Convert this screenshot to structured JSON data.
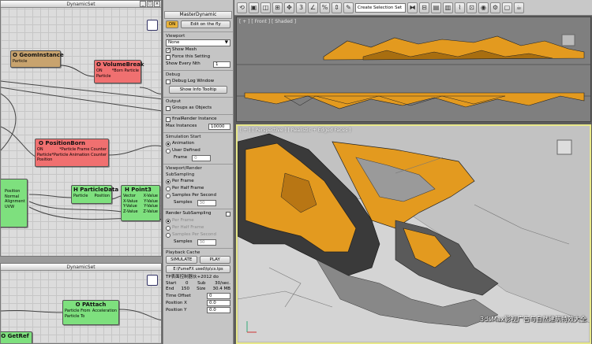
{
  "graph": {
    "title": "DynamicSet",
    "nodes": {
      "geom": {
        "title": "O GeomInstance",
        "left": "Particle"
      },
      "volume": {
        "title": "O VolumeBreak",
        "in1": "ON",
        "out1": "*Born Particle",
        "in2": "Particle"
      },
      "born": {
        "title": "O PositionBorn",
        "in1": "ON",
        "out1": "*Particle Frame Counter",
        "in2": "Particle",
        "out2": "*Particle Animation Counter",
        "in3": "Position"
      },
      "partial": {
        "lines": [
          "Position",
          "Normal",
          "Alignment",
          "UVW"
        ]
      },
      "pdata": {
        "title": "H ParticleData",
        "p1": "Particle",
        "p2": "Position"
      },
      "point3": {
        "title": "H Point3",
        "rows": [
          [
            "Vector",
            "X-Value"
          ],
          [
            "X-Value",
            "Y-Value"
          ],
          [
            "Y-Value",
            "Y-Value"
          ],
          [
            "Z-Value",
            "Z-Value"
          ]
        ]
      }
    }
  },
  "graph2": {
    "title": "DynamicSet",
    "nodes": {
      "attach": {
        "title": "O PAttach",
        "r1a": "Particle From",
        "r1b": "Acceleration",
        "r2": "Particle To"
      },
      "getref": {
        "title": "O GetRef"
      }
    }
  },
  "panel": {
    "title": "MasterDynamic",
    "on_label": "ON",
    "edit_label": "Edit on the fly",
    "viewport": {
      "header": "Viewport",
      "select": "None",
      "show_mesh": "Show Mesh",
      "force": "Force this Setting",
      "show_every": "Show Every Nth",
      "show_every_val": "1"
    },
    "debug": {
      "header": "Debug",
      "log": "Debug Log Window",
      "tooltip": "Show Info Tooltip"
    },
    "output": {
      "header": "Output",
      "groups": "Groups as Objects"
    },
    "render": {
      "final": "finalRender Instance",
      "max_label": "Max Instances",
      "max_val": "10000"
    },
    "sim": {
      "header": "Simulation Start",
      "animation": "Animation",
      "user": "User Defined",
      "frame": "Frame",
      "frame_val": "0"
    },
    "vrs": {
      "header": "Viewport/Render SubSampling",
      "per_frame": "Per Frame",
      "per_half": "Per Half Frame",
      "per_second": "Samples Per Second",
      "samples": "Samples",
      "samples_val": "30"
    },
    "rs": {
      "header": "Render SubSampling",
      "per_frame": "Per Frame",
      "per_half": "Per Half Frame",
      "per_second": "Samples Per Second",
      "samples": "Samples",
      "samples_val": "30"
    },
    "cache": {
      "header": "Playback Cache",
      "simulate": "SIMULATE",
      "play": "PLAY",
      "path": "E:\\FumeFX used\\tp\\cs.tps"
    },
    "info": {
      "line1": "TP表面控制器伙+2012 do",
      "start_label": "Start",
      "start_val": "0",
      "sub_label": "Sub",
      "sub_val": "30/sec.",
      "end_label": "End",
      "end_val": "150",
      "size_label": "Size",
      "size_val": "30.4 MB"
    },
    "time_offset": {
      "label": "Time Offset",
      "val": "0"
    },
    "posx": {
      "label": "Position X",
      "val": "0.0"
    },
    "posy": {
      "label": "Position Y",
      "val": "0.0"
    }
  },
  "toolbar": {
    "selection_set": "Create Selection Set"
  },
  "viewports": {
    "front_label": "[ + ] [ Front ] [ Shaded ]",
    "persp_label": "[ + ] [ Perspective ] [ Realistic + Edged Faces ]",
    "watermark": "3dsMax影视广告与自然建筑特效大全"
  },
  "colors": {
    "fragment": "#e39a1f",
    "node_red": "#f07070",
    "node_green": "#7ee07e",
    "node_geom": "#c8a36e"
  }
}
